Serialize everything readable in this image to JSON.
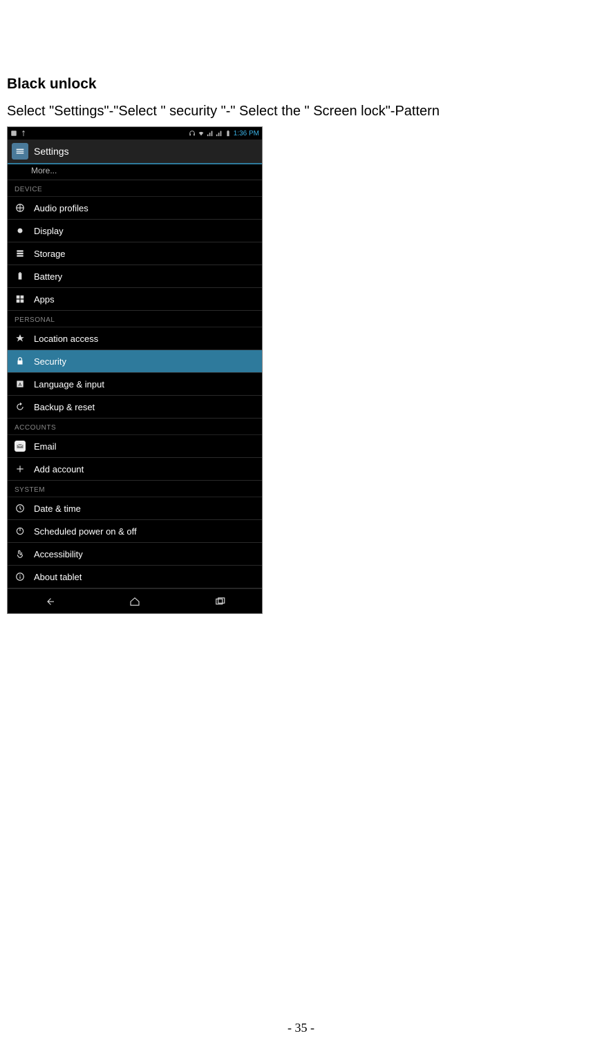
{
  "doc": {
    "heading": "Black unlock",
    "instruction": "Select \"Settings\"-\"Select \" security \"-\" Select the \" Screen lock\"-Pattern",
    "page_number": "- 35 -"
  },
  "phone": {
    "statusbar": {
      "time": "1:36 PM"
    },
    "appbar": {
      "title": "Settings"
    },
    "more_label": "More...",
    "sections": {
      "device": {
        "header": "DEVICE",
        "items": [
          {
            "key": "audio",
            "label": "Audio profiles"
          },
          {
            "key": "display",
            "label": "Display"
          },
          {
            "key": "storage",
            "label": "Storage"
          },
          {
            "key": "battery",
            "label": "Battery"
          },
          {
            "key": "apps",
            "label": "Apps"
          }
        ]
      },
      "personal": {
        "header": "PERSONAL",
        "items": [
          {
            "key": "location",
            "label": "Location access"
          },
          {
            "key": "security",
            "label": "Security",
            "selected": true
          },
          {
            "key": "language",
            "label": "Language & input"
          },
          {
            "key": "backup",
            "label": "Backup & reset"
          }
        ]
      },
      "accounts": {
        "header": "ACCOUNTS",
        "items": [
          {
            "key": "email",
            "label": "Email"
          },
          {
            "key": "add",
            "label": "Add account"
          }
        ]
      },
      "system": {
        "header": "SYSTEM",
        "items": [
          {
            "key": "datetime",
            "label": "Date & time"
          },
          {
            "key": "scheduled",
            "label": "Scheduled power on & off"
          },
          {
            "key": "accessibility",
            "label": "Accessibility"
          },
          {
            "key": "about",
            "label": "About tablet"
          }
        ]
      }
    }
  }
}
